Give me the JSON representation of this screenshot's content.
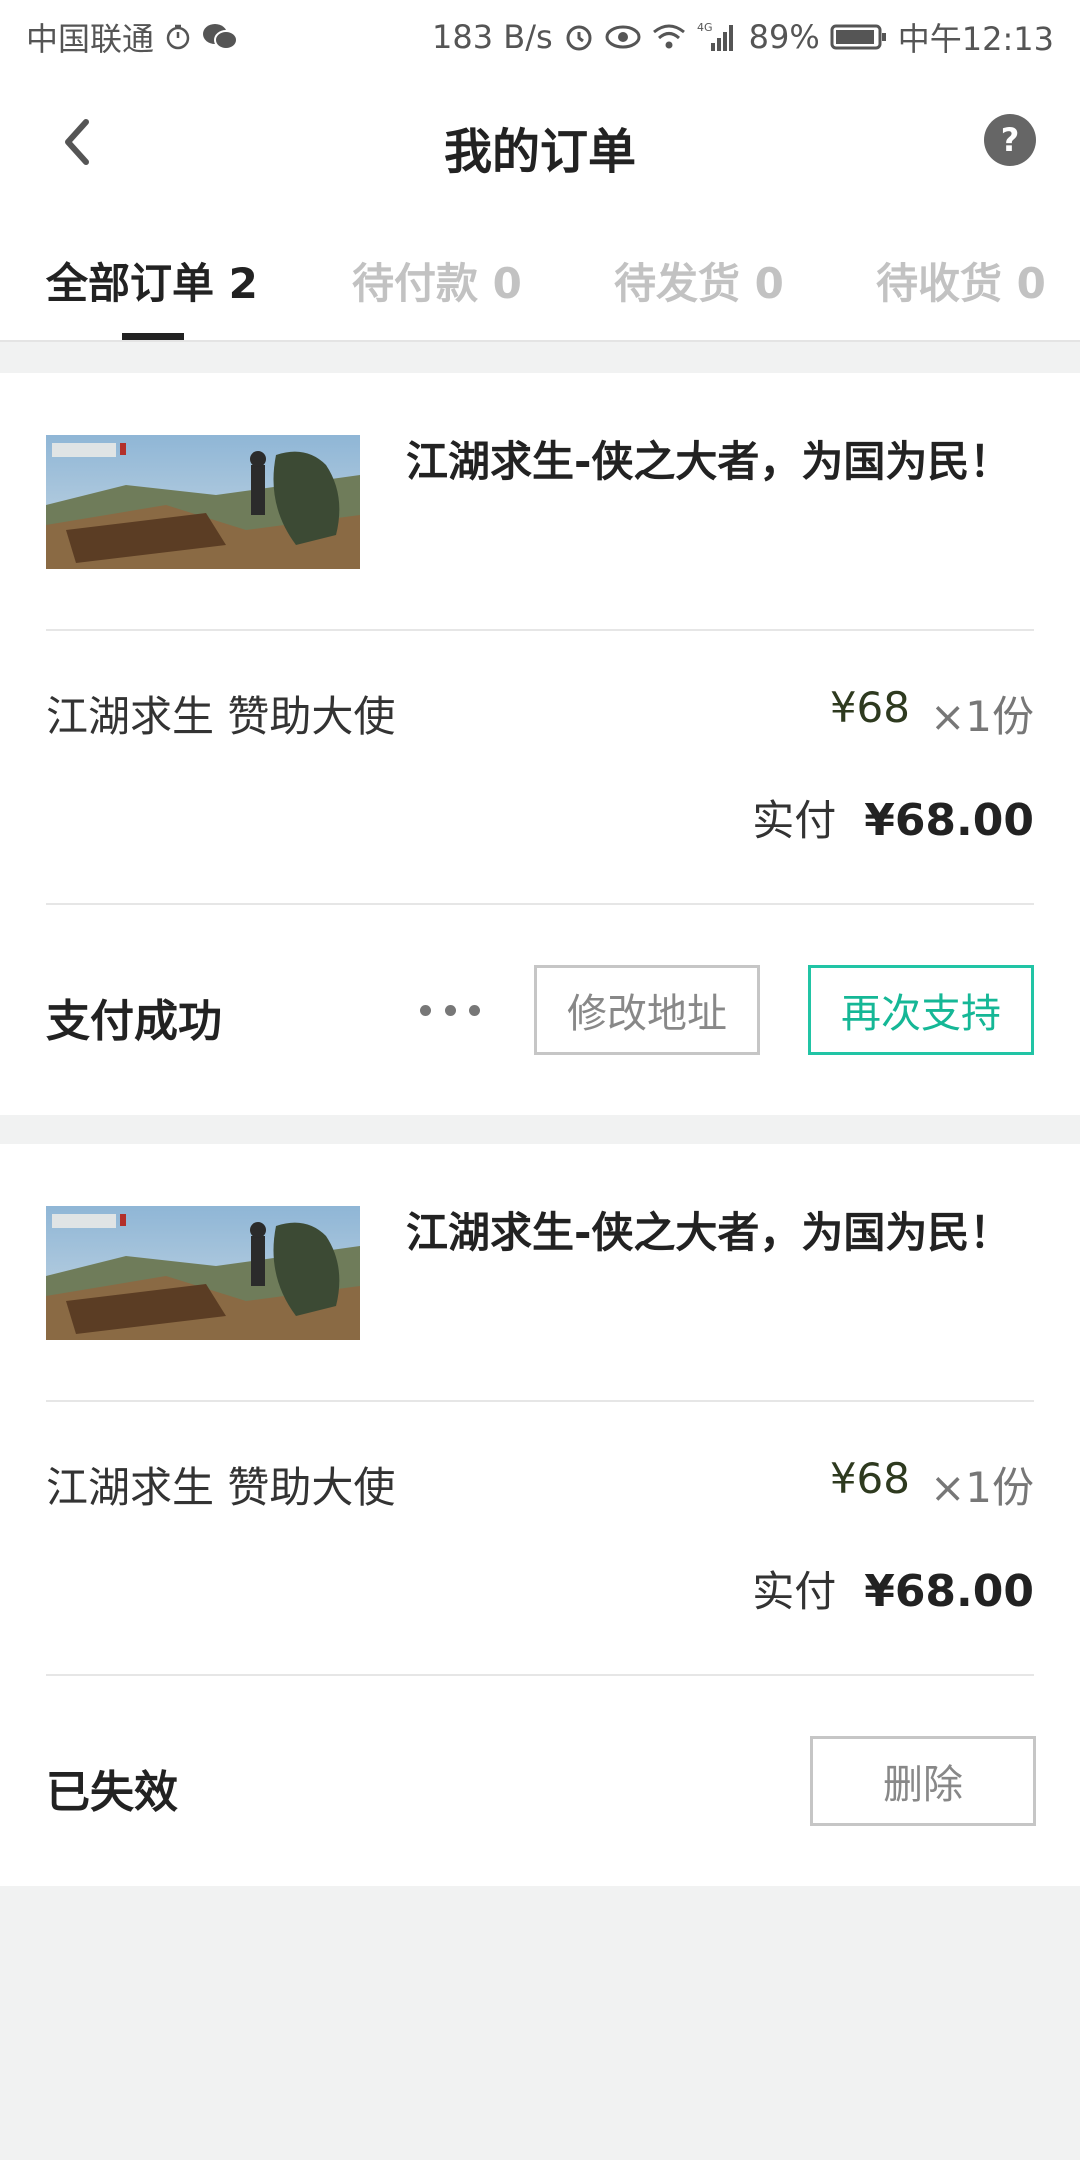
{
  "status_bar": {
    "carrier": "中国联通",
    "net_speed": "183 B/s",
    "network": "4G",
    "battery": "89%",
    "time": "中午12:13"
  },
  "header": {
    "title": "我的订单",
    "back_icon": "chevron-left-icon",
    "help_icon": "question-circle-icon"
  },
  "tabs": [
    {
      "label": "全部订单 2",
      "active": true
    },
    {
      "label": "待付款 0",
      "active": false
    },
    {
      "label": "待发货 0",
      "active": false
    },
    {
      "label": "待收货 0",
      "active": false
    }
  ],
  "orders": [
    {
      "product_title": "江湖求生-侠之大者，为国为民！",
      "item_name": "江湖求生 赞助大使",
      "price": "¥68",
      "quantity": "×1份",
      "paid_label": "实付",
      "paid_amount": "¥68.00",
      "status": "支付成功",
      "actions": {
        "edit_address": "修改地址",
        "support_again": "再次支持"
      }
    },
    {
      "product_title": "江湖求生-侠之大者，为国为民！",
      "item_name": "江湖求生 赞助大使",
      "price": "¥68",
      "quantity": "×1份",
      "paid_label": "实付",
      "paid_amount": "¥68.00",
      "status": "已失效",
      "actions": {
        "delete": "删除"
      }
    }
  ],
  "colors": {
    "accent": "#15b796",
    "page_bg": "#f1f2f2"
  }
}
